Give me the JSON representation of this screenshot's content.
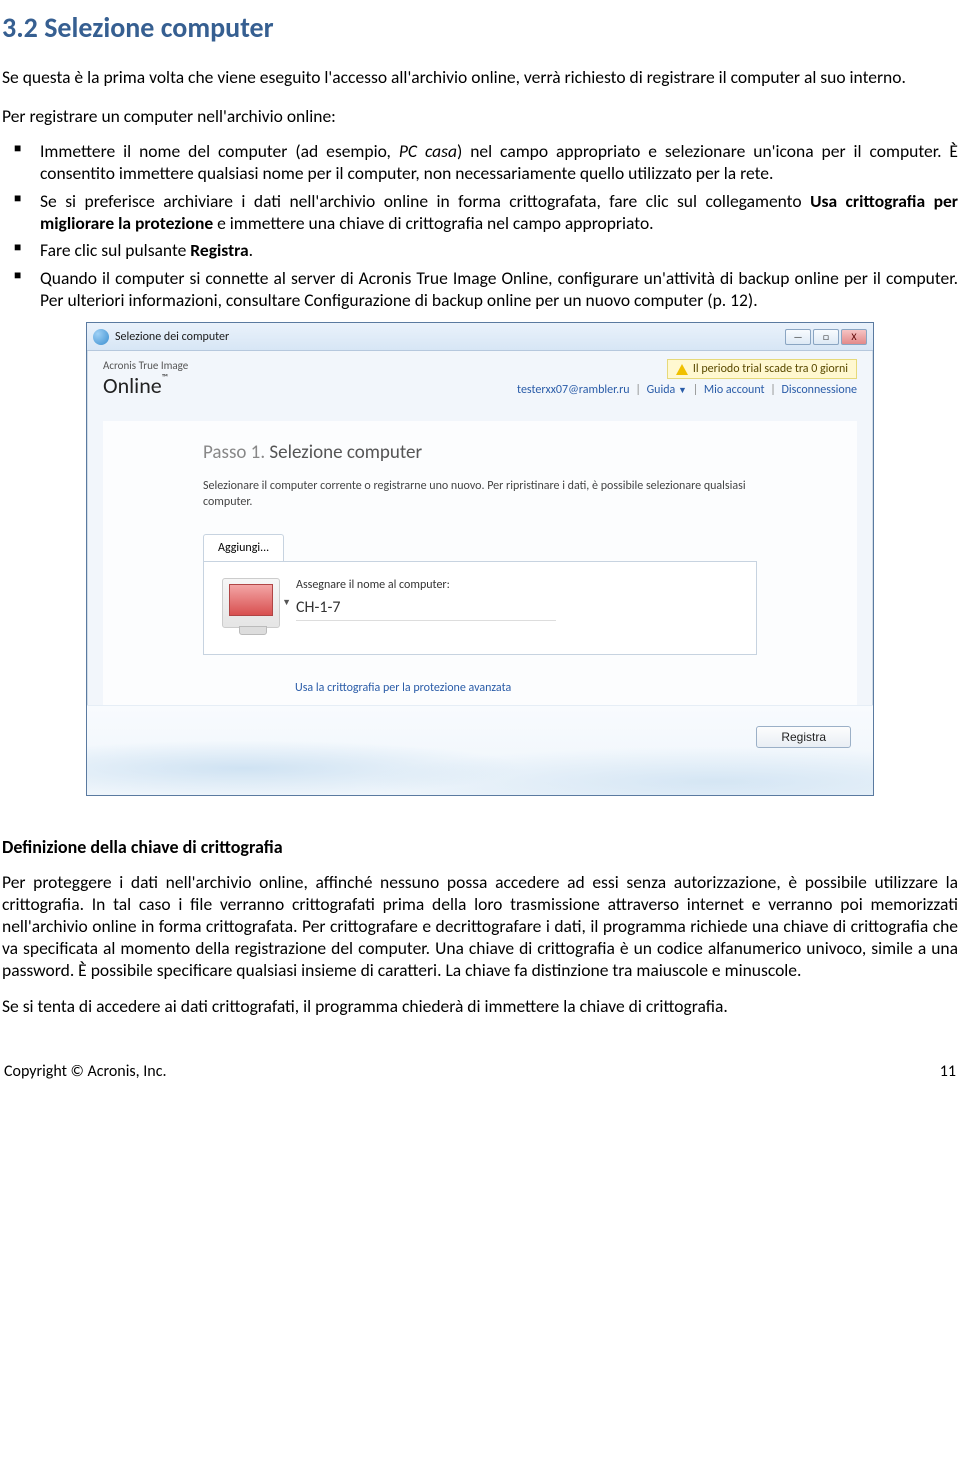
{
  "heading": "3.2   Selezione computer",
  "intro": "Se questa è la prima volta che viene eseguito l'accesso all'archivio online, verrà richiesto di registrare il computer al suo interno.",
  "subhead": "Per registrare un computer nell'archivio online:",
  "bullets": [
    {
      "pre": "Immettere il nome del computer (ad esempio, ",
      "italic": "PC casa",
      "post": ") nel campo appropriato e selezionare un'icona per il computer. È consentito immettere qualsiasi nome per il computer, non necessariamente quello utilizzato per la rete."
    },
    {
      "pre": "Se si preferisce archiviare i dati nell'archivio online in forma crittografata, fare clic sul collegamento ",
      "bold": "Usa crittografia per migliorare la protezione",
      "post": " e immettere una chiave di crittografia nel campo appropriato."
    },
    {
      "pre": "Fare clic sul pulsante ",
      "bold": "Registra",
      "post": "."
    },
    {
      "pre": "Quando il computer si connette al server di Acronis True Image Online, configurare un'attività di backup online per il computer. Per ulteriori informazioni, consultare Configurazione di backup online per un nuovo computer (p. 12)."
    }
  ],
  "window": {
    "title": "Selezione dei computer",
    "brand_line1": "Acronis True Image",
    "brand_line2": "Online",
    "trial_text": "Il periodo trial scade tra 0 giorni",
    "acct_email": "testerxx07@rambler.ru",
    "acct_guida": "Guida",
    "acct_mio": "Mio account",
    "acct_disc": "Disconnessione",
    "step_thin": "Passo 1.",
    "step_bold": "Selezione computer",
    "step_desc": "Selezionare il computer corrente o registrarne uno nuovo. Per ripristinare i dati, è possibile selezionare qualsiasi computer.",
    "tab_label": "Aggiungi...",
    "form_label": "Assegnare il nome al computer:",
    "computer_name": "CH-1-7",
    "crypto_link": "Usa la crittografia per la protezione avanzata",
    "register_btn": "Registra",
    "min": "—",
    "max": "□",
    "close": "X"
  },
  "def_heading": "Definizione della chiave di crittografia",
  "def_p1": "Per proteggere i dati nell'archivio online, affinché nessuno possa accedere ad essi senza autorizzazione, è possibile utilizzare la crittografia. In tal caso i file verranno crittografati prima della loro trasmissione attraverso internet e verranno poi memorizzati nell'archivio online in forma crittografata. Per crittografare e decrittografare i dati, il programma richiede una chiave di crittografia che va specificata al momento della registrazione del computer. Una chiave di crittografia è un codice alfanumerico univoco, simile a una password. È possibile specificare qualsiasi insieme di caratteri. La chiave fa distinzione tra maiuscole e minuscole.",
  "def_p2": "Se si tenta di accedere ai dati crittografati, il programma chiederà di immettere la chiave di crittografia.",
  "footer_left": "Copyright © Acronis, Inc.",
  "footer_right": "11"
}
